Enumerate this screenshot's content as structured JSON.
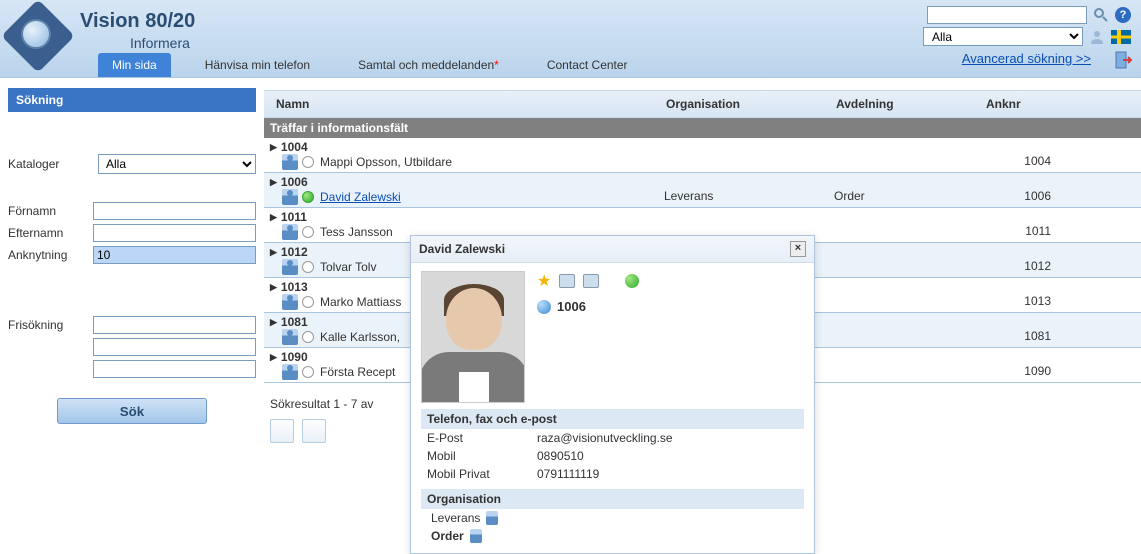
{
  "brand": {
    "title": "Vision 80/20",
    "subtitle": "Informera"
  },
  "tabs": [
    {
      "label": "Min sida",
      "active": true
    },
    {
      "label": "Hänvisa min telefon"
    },
    {
      "label": "Samtal och meddelanden",
      "asterisk": true
    },
    {
      "label": "Contact Center"
    }
  ],
  "headerSearch": {
    "selectValue": "Alla",
    "advanced": "Avancerad sökning >>"
  },
  "sidebar": {
    "title": "Sökning",
    "katalogerLabel": "Kataloger",
    "katalogerValue": "Alla",
    "fornamnLabel": "Förnamn",
    "efternamnLabel": "Efternamn",
    "anknytningLabel": "Anknytning",
    "anknytningValue": "10",
    "frisokningLabel": "Frisökning",
    "searchButton": "Sök"
  },
  "table": {
    "headers": {
      "namn": "Namn",
      "org": "Organisation",
      "avd": "Avdelning",
      "anknr": "Anknr"
    },
    "sectionLabel": "Träffar i informationsfält",
    "rows": [
      {
        "num": "1004",
        "name": "Mappi Opsson, Utbildare",
        "org": "",
        "avd": "",
        "anknr": "1004",
        "green": false,
        "link": false
      },
      {
        "num": "1006",
        "name": "David Zalewski",
        "org": "Leverans",
        "avd": "Order",
        "anknr": "1006",
        "green": true,
        "link": true,
        "alt": true
      },
      {
        "num": "1011",
        "name": "Tess Jansson",
        "org": "",
        "avd": "",
        "anknr": "1011",
        "green": false,
        "link": false
      },
      {
        "num": "1012",
        "name": "Tolvar Tolv",
        "org": "",
        "avd": "",
        "anknr": "1012",
        "green": false,
        "link": false,
        "alt": true
      },
      {
        "num": "1013",
        "name": "Marko Mattiass",
        "org": "",
        "avd": "",
        "anknr": "1013",
        "green": false,
        "link": false
      },
      {
        "num": "1081",
        "name": "Kalle Karlsson,",
        "org": "",
        "avd": "",
        "anknr": "1081",
        "green": false,
        "link": false,
        "alt": true
      },
      {
        "num": "1090",
        "name": "Första Recept",
        "org": "",
        "avd": "",
        "anknr": "1090",
        "green": false,
        "link": false
      }
    ],
    "resultLabel": "Sökresultat 1 - 7 av"
  },
  "popup": {
    "title": "David Zalewski",
    "number": "1006",
    "contactHeader": "Telefon, fax och e-post",
    "epostLabel": "E-Post",
    "epostValue": "raza@visionutveckling.se",
    "mobilLabel": "Mobil",
    "mobilValue": "0890510",
    "mobilPrivLabel": "Mobil Privat",
    "mobilPrivValue": "0791111119",
    "orgHeader": "Organisation",
    "orgRows": [
      {
        "label": "Leverans",
        "bold": false
      },
      {
        "label": "Order",
        "bold": true
      }
    ]
  }
}
